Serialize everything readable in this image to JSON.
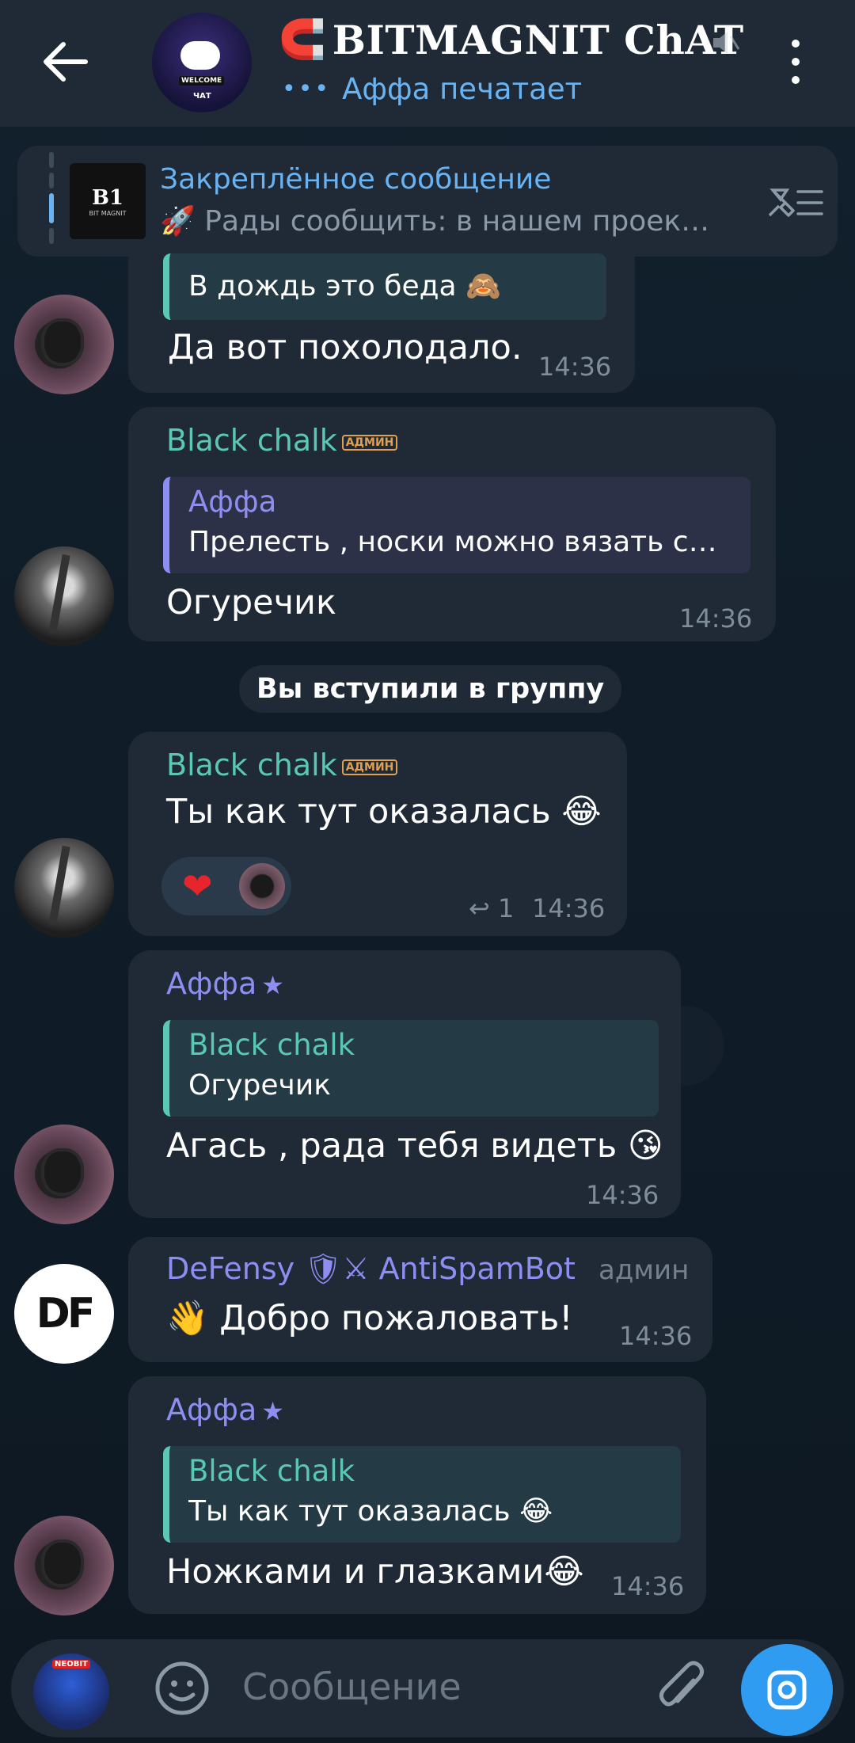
{
  "header": {
    "title": "BITMAGNIT ChAT",
    "status": "Аффа печатает",
    "typing_dots": "•••",
    "avatar_lines": [
      "WELCOME",
      "ЧАТ"
    ]
  },
  "pinned": {
    "label": "Закреплённое сообщение",
    "text": "🚀 Рады сообщить: в нашем проек…",
    "thumb_title": "B1",
    "thumb_sub": "BIT MAGNIT"
  },
  "messages": [
    {
      "reply_text": "В дождь это беда 🙈",
      "text": "Да вот похолодало.",
      "time": "14:36"
    },
    {
      "sender": "Black chalk",
      "badge": "АДМИН",
      "reply_name": "Аффа",
      "reply_text": "Прелесть , носки можно вязать с…",
      "text": "Огуречик",
      "time": "14:36"
    },
    {
      "sender": "Black chalk",
      "badge": "АДМИН",
      "text": "Ты как тут оказалась 😂",
      "reaction": "❤",
      "reply_icon": "↩",
      "reply_count": "1",
      "time": "14:36"
    },
    {
      "sender": "Аффа",
      "star": "★",
      "reply_name": "Black chalk",
      "reply_text": "Огуречик",
      "text": "Агась , рада тебя видеть 😘",
      "time": "14:36"
    },
    {
      "sender": "DeFensy 🛡⚔ AntiSpamBot",
      "admin_tag": "админ",
      "text": "👋 Добро пожаловать!",
      "time": "14:36"
    },
    {
      "sender": "Аффа",
      "star": "★",
      "reply_name": "Black chalk",
      "reply_text": "Ты как тут оказалась 😂",
      "text": "Ножками и глазками😂",
      "time": "14:36"
    }
  ],
  "service": {
    "text": "Вы вступили в группу"
  },
  "avatars": {
    "defensy": "DF"
  },
  "input": {
    "placeholder": "Сообщение",
    "avatar_badge": "NEOBIT"
  },
  "colors": {
    "accent": "#6ab3f3",
    "green_name": "#5ac8b4",
    "purple_name": "#8e8ef2",
    "bubble": "#1f2a36",
    "camera_button": "#2f9cf2"
  },
  "icons": {
    "back": "arrow-left-icon",
    "mute": "mute-icon",
    "menu": "more-vertical-icon",
    "pin_list": "pin-list-icon",
    "emoji": "smile-icon",
    "attach": "paperclip-icon",
    "camera": "camera-icon"
  }
}
